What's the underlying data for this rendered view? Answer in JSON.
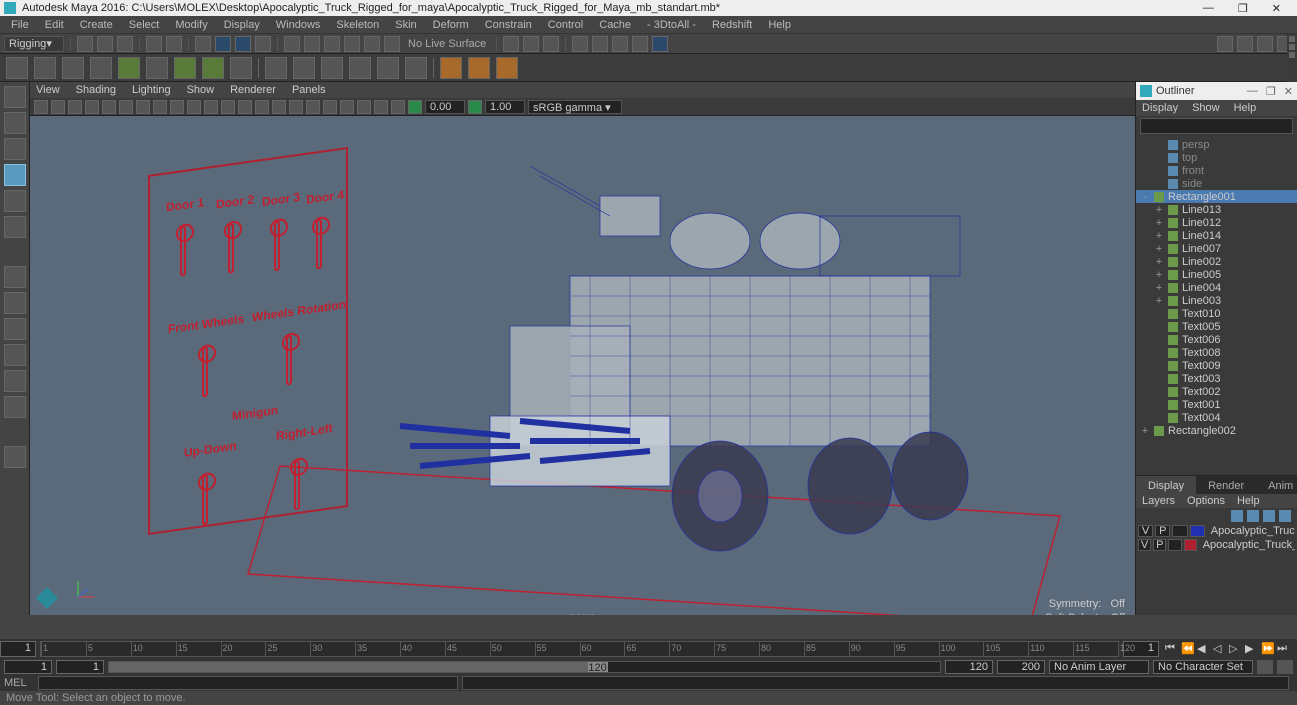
{
  "window": {
    "title": "Autodesk Maya 2016: C:\\Users\\MOLEX\\Desktop\\Apocalyptic_Truck_Rigged_for_maya\\Apocalyptic_Truck_Rigged_for_Maya_mb_standart.mb*",
    "minimize": "—",
    "maximize": "❐",
    "close": "✕"
  },
  "menubar": [
    "File",
    "Edit",
    "Create",
    "Select",
    "Modify",
    "Display",
    "Windows",
    "Skeleton",
    "Skin",
    "Deform",
    "Constrain",
    "Control",
    "Cache",
    "- 3DtoAll -",
    "Redshift",
    "Help"
  ],
  "shelf": {
    "workspace": "Rigging",
    "liveText": "No Live Surface"
  },
  "viewportMenu": [
    "View",
    "Shading",
    "Lighting",
    "Show",
    "Renderer",
    "Panels"
  ],
  "viewportTools": {
    "num1": "0.00",
    "num2": "1.00",
    "gamma": "sRGB gamma"
  },
  "viewport": {
    "label": "persp",
    "symmetry": "Symmetry:",
    "symmetryVal": "Off",
    "softsel": "Soft Select:",
    "softselVal": "Off"
  },
  "rig": {
    "door1": "Door 1",
    "door2": "Door 2",
    "door3": "Door 3",
    "door4": "Door 4",
    "frontWheels": "Front Wheels",
    "wheelsRot": "Wheels Rotation",
    "minigun": "Minigun",
    "updown": "Up-Down",
    "rightleft": "Right-Left"
  },
  "outliner": {
    "title": "Outliner",
    "min": "—",
    "max": "❐",
    "close": "✕",
    "menu": [
      "Display",
      "Show",
      "Help"
    ],
    "items": [
      {
        "name": "persp",
        "indent": 1,
        "dim": true,
        "icon": "cam"
      },
      {
        "name": "top",
        "indent": 1,
        "dim": true,
        "icon": "cam"
      },
      {
        "name": "front",
        "indent": 1,
        "dim": true,
        "icon": "cam"
      },
      {
        "name": "side",
        "indent": 1,
        "dim": true,
        "icon": "cam"
      },
      {
        "name": "Rectangle001",
        "indent": 0,
        "exp": "-",
        "sel": true,
        "icon": "curve"
      },
      {
        "name": "Line013",
        "indent": 1,
        "exp": "+",
        "icon": "curve"
      },
      {
        "name": "Line012",
        "indent": 1,
        "exp": "+",
        "icon": "curve"
      },
      {
        "name": "Line014",
        "indent": 1,
        "exp": "+",
        "icon": "curve"
      },
      {
        "name": "Line007",
        "indent": 1,
        "exp": "+",
        "icon": "curve"
      },
      {
        "name": "Line002",
        "indent": 1,
        "exp": "+",
        "icon": "curve"
      },
      {
        "name": "Line005",
        "indent": 1,
        "exp": "+",
        "icon": "curve"
      },
      {
        "name": "Line004",
        "indent": 1,
        "exp": "+",
        "icon": "curve"
      },
      {
        "name": "Line003",
        "indent": 1,
        "exp": "+",
        "icon": "curve"
      },
      {
        "name": "Text010",
        "indent": 1,
        "icon": "curve"
      },
      {
        "name": "Text005",
        "indent": 1,
        "icon": "curve"
      },
      {
        "name": "Text006",
        "indent": 1,
        "icon": "curve"
      },
      {
        "name": "Text008",
        "indent": 1,
        "icon": "curve"
      },
      {
        "name": "Text009",
        "indent": 1,
        "icon": "curve"
      },
      {
        "name": "Text003",
        "indent": 1,
        "icon": "curve"
      },
      {
        "name": "Text002",
        "indent": 1,
        "icon": "curve"
      },
      {
        "name": "Text001",
        "indent": 1,
        "icon": "curve"
      },
      {
        "name": "Text004",
        "indent": 1,
        "icon": "curve"
      },
      {
        "name": "Rectangle002",
        "indent": 0,
        "exp": "+",
        "icon": "curve"
      }
    ]
  },
  "layers": {
    "tabs": [
      "Display",
      "Render",
      "Anim"
    ],
    "menu": [
      "Layers",
      "Options",
      "Help"
    ],
    "rows": [
      {
        "v": "V",
        "p": "P",
        "color": "#2030b0",
        "name": "Apocalyptic_Truck"
      },
      {
        "v": "V",
        "p": "P",
        "color": "#b02030",
        "name": "Apocalyptic_Truck_Con"
      }
    ]
  },
  "timeline": {
    "ticks": [
      1,
      5,
      10,
      15,
      20,
      25,
      30,
      35,
      40,
      45,
      50,
      55,
      60,
      65,
      70,
      75,
      80,
      85,
      90,
      95,
      100,
      105,
      110,
      115,
      120
    ],
    "current": "1"
  },
  "range": {
    "start": "1",
    "innerStart": "1",
    "innerEnd": "120",
    "end": "120",
    "total": "200",
    "animLayer": "No Anim Layer",
    "charSet": "No Character Set"
  },
  "cmd": {
    "label": "MEL"
  },
  "status": "Move Tool: Select an object to move."
}
